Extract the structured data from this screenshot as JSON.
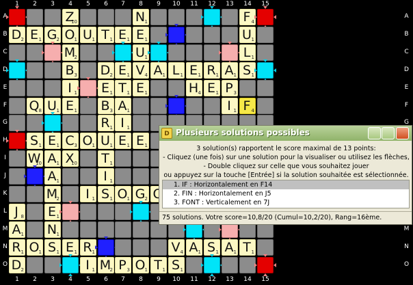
{
  "colors": {
    "background": "#000000",
    "tile": "#fcf8c4",
    "new_tile": "#f6e848",
    "triple_word": "#e40000",
    "double_word": "#f6aeae",
    "triple_letter": "#2020ff",
    "double_letter": "#00e4f8",
    "empty": "#8c8c8c"
  },
  "col_labels": [
    "1",
    "2",
    "3",
    "4",
    "5",
    "6",
    "7",
    "8",
    "9",
    "10",
    "11",
    "12",
    "13",
    "14",
    "15"
  ],
  "row_labels": [
    "A",
    "B",
    "C",
    "D",
    "E",
    "F",
    "G",
    "H",
    "I",
    "J",
    "K",
    "L",
    "M",
    "N",
    "O"
  ],
  "premium": [
    [
      "TW",
      0,
      0
    ],
    [
      "TW",
      0,
      14
    ],
    [
      "TW",
      7,
      0
    ],
    [
      "TW",
      14,
      14
    ],
    [
      "DW",
      2,
      2
    ],
    [
      "DW",
      4,
      4
    ],
    [
      "DW",
      2,
      12
    ],
    [
      "DW",
      11,
      3
    ],
    [
      "DW",
      12,
      12
    ],
    [
      "DW",
      7,
      7
    ],
    [
      "TL",
      1,
      9
    ],
    [
      "TL",
      5,
      9
    ],
    [
      "TL",
      9,
      1
    ],
    [
      "TL",
      13,
      5
    ],
    [
      "DL",
      0,
      3
    ],
    [
      "DL",
      0,
      11
    ],
    [
      "DL",
      2,
      6
    ],
    [
      "DL",
      2,
      8
    ],
    [
      "DL",
      3,
      0
    ],
    [
      "DL",
      3,
      14
    ],
    [
      "DL",
      6,
      2
    ],
    [
      "DL",
      11,
      7
    ],
    [
      "DL",
      14,
      3
    ],
    [
      "DL",
      14,
      11
    ],
    [
      "DL",
      12,
      10
    ]
  ],
  "tiles": [
    {
      "l": "Z",
      "p": "10",
      "r": 0,
      "c": 3
    },
    {
      "l": "N",
      "p": "1",
      "r": 0,
      "c": 7
    },
    {
      "l": "F",
      "p": "4",
      "r": 0,
      "c": 13
    },
    {
      "l": "D",
      "p": "2",
      "r": 1,
      "c": 0
    },
    {
      "l": "E",
      "p": "1",
      "r": 1,
      "c": 1
    },
    {
      "l": "G",
      "p": "2",
      "r": 1,
      "c": 2
    },
    {
      "l": "O",
      "p": "1",
      "r": 1,
      "c": 3
    },
    {
      "l": "U",
      "p": "1",
      "r": 1,
      "c": 4
    },
    {
      "l": "T",
      "p": "1",
      "r": 1,
      "c": 5
    },
    {
      "l": "E",
      "p": "1",
      "r": 1,
      "c": 6
    },
    {
      "l": "E",
      "p": "1",
      "r": 1,
      "c": 7
    },
    {
      "l": "U",
      "p": "1",
      "r": 1,
      "c": 13
    },
    {
      "l": "M",
      "p": "2",
      "r": 2,
      "c": 3
    },
    {
      "l": "U",
      "p": "1",
      "r": 2,
      "c": 7
    },
    {
      "l": "L",
      "p": "1",
      "r": 2,
      "c": 13
    },
    {
      "l": "B",
      "p": "3",
      "r": 3,
      "c": 3
    },
    {
      "l": "D",
      "p": "2",
      "r": 3,
      "c": 5
    },
    {
      "l": "E",
      "p": "1",
      "r": 3,
      "c": 6
    },
    {
      "l": "V",
      "p": "4",
      "r": 3,
      "c": 7
    },
    {
      "l": "A",
      "p": "1",
      "r": 3,
      "c": 8
    },
    {
      "l": "L",
      "p": "1",
      "r": 3,
      "c": 9
    },
    {
      "l": "E",
      "p": "1",
      "r": 3,
      "c": 10
    },
    {
      "l": "R",
      "p": "1",
      "r": 3,
      "c": 11
    },
    {
      "l": "A",
      "p": "1",
      "r": 3,
      "c": 12
    },
    {
      "l": "S",
      "p": "1",
      "r": 3,
      "c": 13
    },
    {
      "l": "I",
      "p": "1",
      "r": 4,
      "c": 3
    },
    {
      "l": "E",
      "p": "1",
      "r": 4,
      "c": 5
    },
    {
      "l": "T",
      "p": "1",
      "r": 4,
      "c": 6
    },
    {
      "l": "E",
      "p": "1",
      "r": 4,
      "c": 7
    },
    {
      "l": "H",
      "p": "4",
      "r": 4,
      "c": 10
    },
    {
      "l": "E",
      "p": "1",
      "r": 4,
      "c": 11
    },
    {
      "l": "P",
      "p": "3",
      "r": 4,
      "c": 12
    },
    {
      "l": "Q",
      "p": "8",
      "r": 5,
      "c": 1
    },
    {
      "l": "U",
      "p": "1",
      "r": 5,
      "c": 2
    },
    {
      "l": "E",
      "p": "1",
      "r": 5,
      "c": 3
    },
    {
      "l": "B",
      "p": "3",
      "r": 5,
      "c": 5
    },
    {
      "l": "A",
      "p": "1",
      "r": 5,
      "c": 6
    },
    {
      "l": "I",
      "p": "1",
      "r": 5,
      "c": 12
    },
    {
      "l": "F",
      "p": "4",
      "r": 5,
      "c": 13,
      "new": true
    },
    {
      "l": "R",
      "p": "1",
      "r": 6,
      "c": 5
    },
    {
      "l": "I",
      "p": "1",
      "r": 6,
      "c": 6
    },
    {
      "l": "S",
      "p": "1",
      "r": 7,
      "c": 1
    },
    {
      "l": "E",
      "p": "1",
      "r": 7,
      "c": 2
    },
    {
      "l": "C",
      "p": "3",
      "r": 7,
      "c": 3
    },
    {
      "l": "O",
      "p": "1",
      "r": 7,
      "c": 4
    },
    {
      "l": "U",
      "p": "1",
      "r": 7,
      "c": 5
    },
    {
      "l": "E",
      "p": "1",
      "r": 7,
      "c": 6
    },
    {
      "l": "E",
      "p": "1",
      "r": 7,
      "c": 7
    },
    {
      "l": "W",
      "p": "10",
      "r": 8,
      "c": 1
    },
    {
      "l": "A",
      "p": "1",
      "r": 8,
      "c": 2
    },
    {
      "l": "X",
      "p": "10",
      "r": 8,
      "c": 3
    },
    {
      "l": "T",
      "p": "1",
      "r": 8,
      "c": 5
    },
    {
      "l": "A",
      "p": "1",
      "r": 9,
      "c": 2
    },
    {
      "l": "I",
      "p": "1",
      "r": 9,
      "c": 5
    },
    {
      "l": "M",
      "p": "2",
      "r": 10,
      "c": 2
    },
    {
      "l": "I",
      "p": "1",
      "r": 10,
      "c": 4
    },
    {
      "l": "S",
      "p": "1",
      "r": 10,
      "c": 5
    },
    {
      "l": "O",
      "p": "1",
      "r": 10,
      "c": 6
    },
    {
      "l": "G",
      "p": "2",
      "r": 10,
      "c": 7
    },
    {
      "l": "O",
      "p": "1",
      "r": 10,
      "c": 8
    },
    {
      "l": "J",
      "p": "8",
      "r": 11,
      "c": 0
    },
    {
      "l": "E",
      "p": "1",
      "r": 11,
      "c": 2
    },
    {
      "l": "A",
      "p": "1",
      "r": 12,
      "c": 0
    },
    {
      "l": "N",
      "p": "1",
      "r": 12,
      "c": 2
    },
    {
      "l": "R",
      "p": "1",
      "r": 13,
      "c": 0
    },
    {
      "l": "O",
      "p": "1",
      "r": 13,
      "c": 1
    },
    {
      "l": "S",
      "p": "1",
      "r": 13,
      "c": 2
    },
    {
      "l": "E",
      "p": "1",
      "r": 13,
      "c": 3
    },
    {
      "l": "R",
      "p": "1",
      "r": 13,
      "c": 4
    },
    {
      "l": "V",
      "p": "4",
      "r": 13,
      "c": 9
    },
    {
      "l": "A",
      "p": "1",
      "r": 13,
      "c": 10
    },
    {
      "l": "S",
      "p": "1",
      "r": 13,
      "c": 11
    },
    {
      "l": "A",
      "p": "1",
      "r": 13,
      "c": 12
    },
    {
      "l": "T",
      "p": "1",
      "r": 13,
      "c": 13
    },
    {
      "l": "D",
      "p": "2",
      "r": 14,
      "c": 0
    },
    {
      "l": "I",
      "p": "1",
      "r": 14,
      "c": 4
    },
    {
      "l": "M",
      "p": "2",
      "r": 14,
      "c": 5
    },
    {
      "l": "P",
      "p": "3",
      "r": 14,
      "c": 6
    },
    {
      "l": "O",
      "p": "1",
      "r": 14,
      "c": 7
    },
    {
      "l": "T",
      "p": "1",
      "r": 14,
      "c": 8
    },
    {
      "l": "S",
      "p": "1",
      "r": 14,
      "c": 9
    }
  ],
  "dialog": {
    "title": "Plusieurs solutions possibles",
    "icon_label": "D",
    "message": [
      "3 solution(s) rapportent le score maximal de 13 points:",
      "- Cliquez (une fois) sur une solution pour la visualiser ou utilisez les flèches,",
      "- Double cliquez sur celle que vous souhaitez jouer",
      "ou appuyez sur la touche [Entrée] si la solution souhaitée est sélectionnée."
    ],
    "solutions": [
      "1. IF : Horizontalement en F14",
      "2. FIN : Horizontalement en J5",
      "3. FONT : Verticalement en 7J"
    ],
    "selected_index": 0,
    "status": "75 solutions. Votre score=10,8/20 (Cumul=10,2/20), Rang=16ème."
  }
}
